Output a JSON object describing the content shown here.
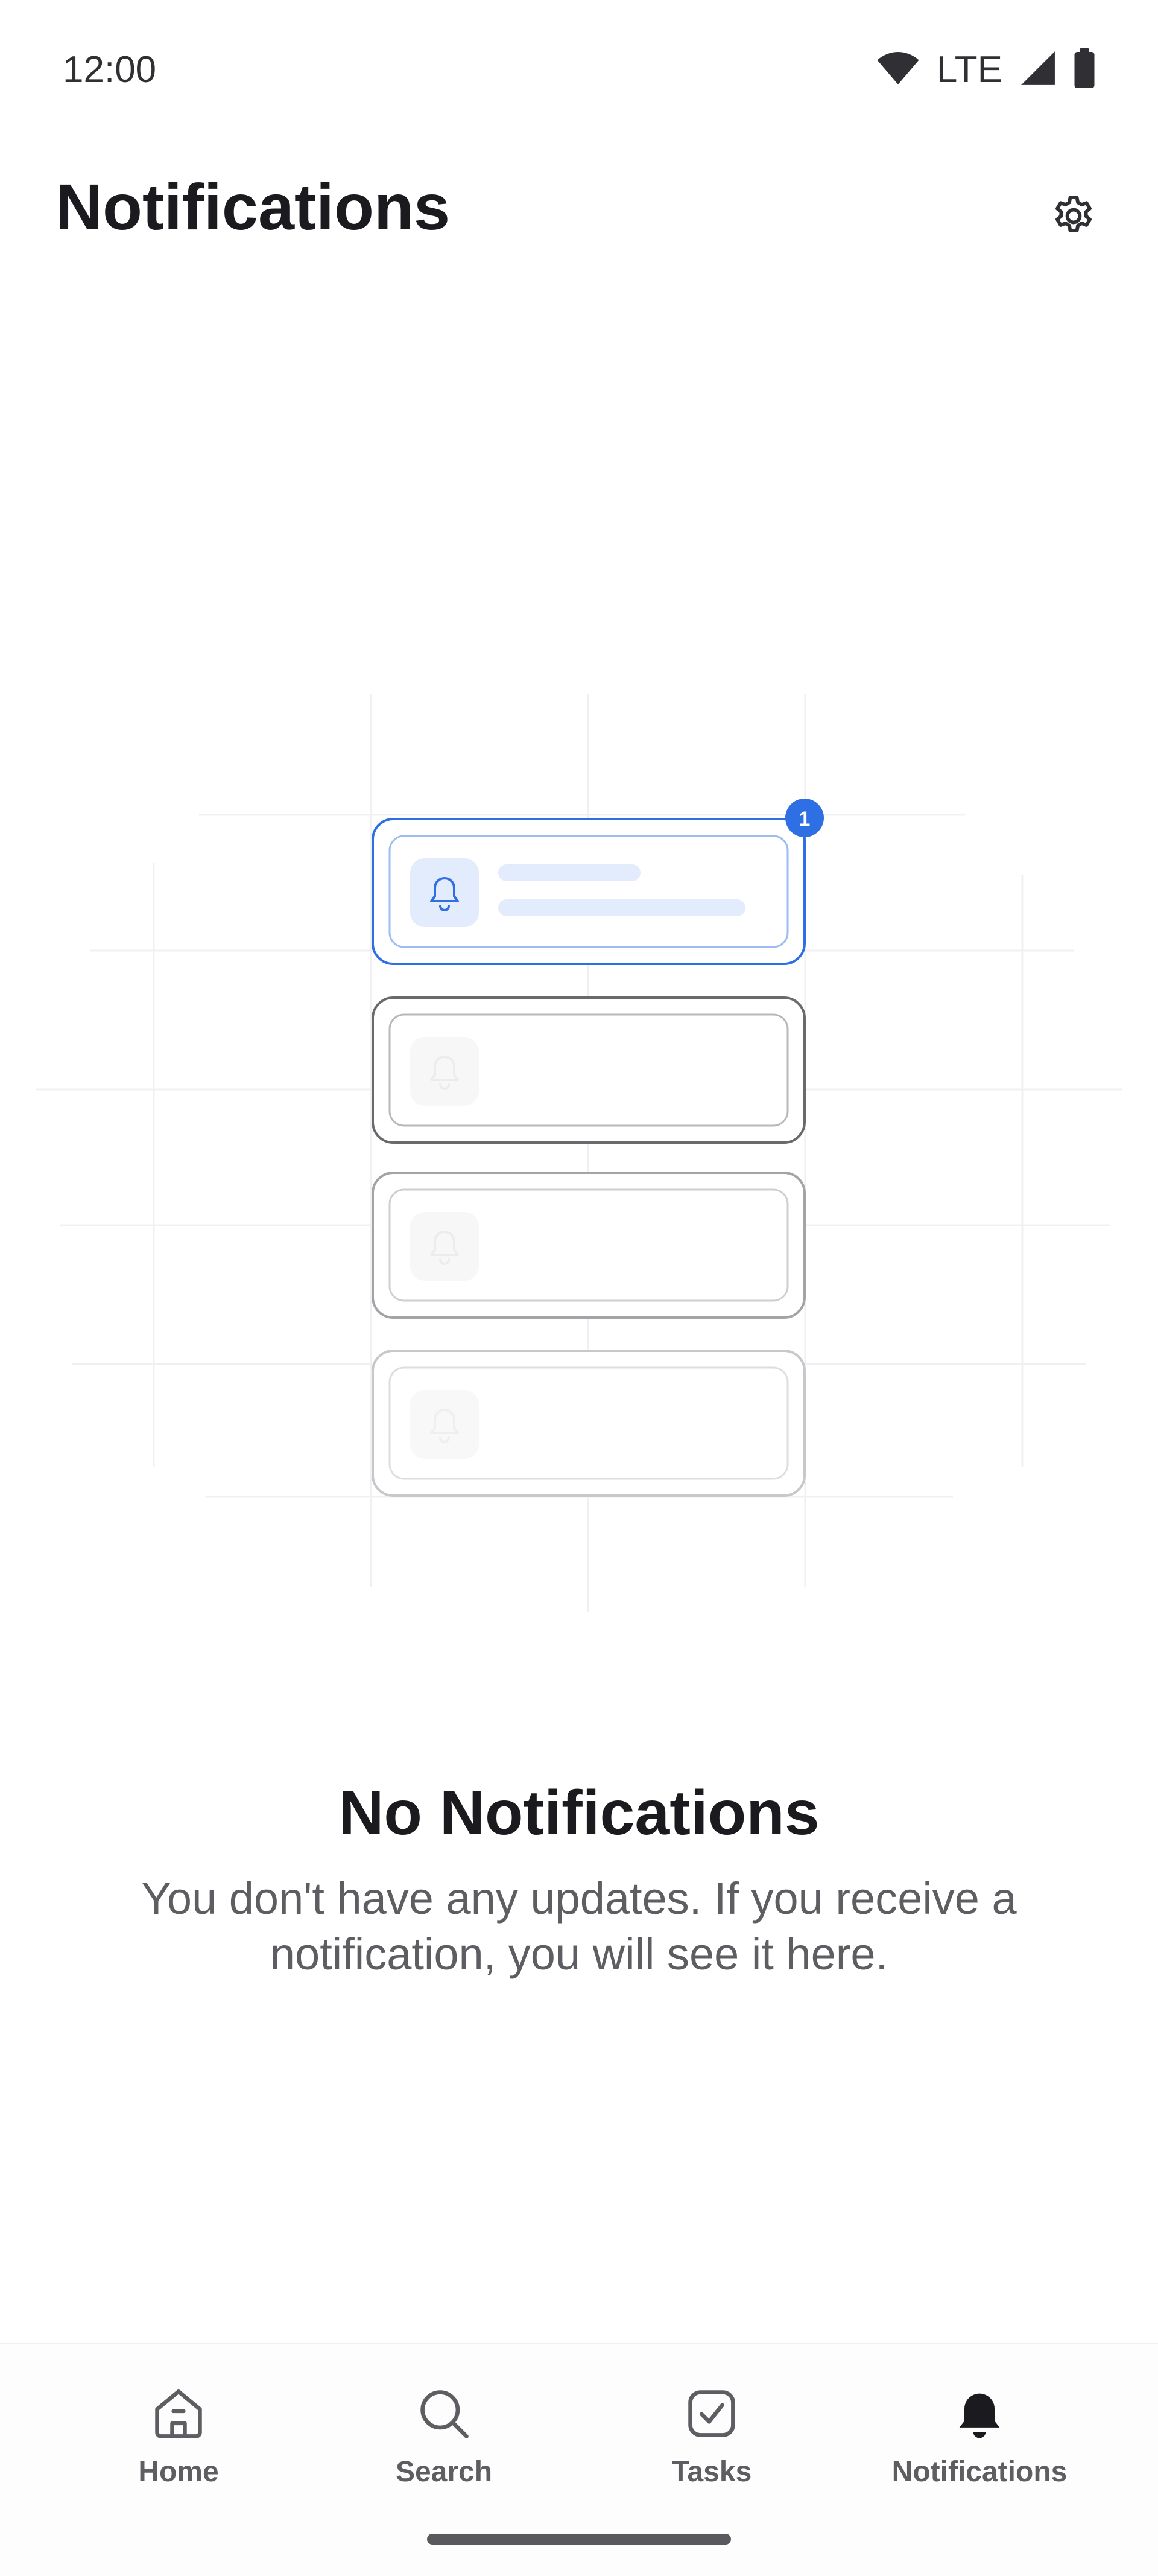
{
  "status_bar": {
    "time": "12:00",
    "network": "LTE",
    "icons": [
      "wifi-icon",
      "cell-signal-icon",
      "battery-icon"
    ]
  },
  "header": {
    "title": "Notifications",
    "settings_icon": "gear-icon"
  },
  "illustration": {
    "badge_count": "1",
    "accent_color": "#2f6fe4",
    "card_count": 4,
    "card_icon": "bell-icon"
  },
  "empty_state": {
    "title": "No Notifications",
    "description": "You don't have any updates. If you receive a notification, you will see it here."
  },
  "bottom_nav": {
    "items": [
      {
        "label": "Home",
        "icon": "home-icon",
        "active": false
      },
      {
        "label": "Search",
        "icon": "search-icon",
        "active": false
      },
      {
        "label": "Tasks",
        "icon": "tasks-checkbox-icon",
        "active": false
      },
      {
        "label": "Notifications",
        "icon": "bell-icon",
        "active": true
      }
    ]
  },
  "colors": {
    "text_primary": "#1b1b1f",
    "text_secondary": "#5e5e62",
    "accent": "#2f6fe4"
  }
}
